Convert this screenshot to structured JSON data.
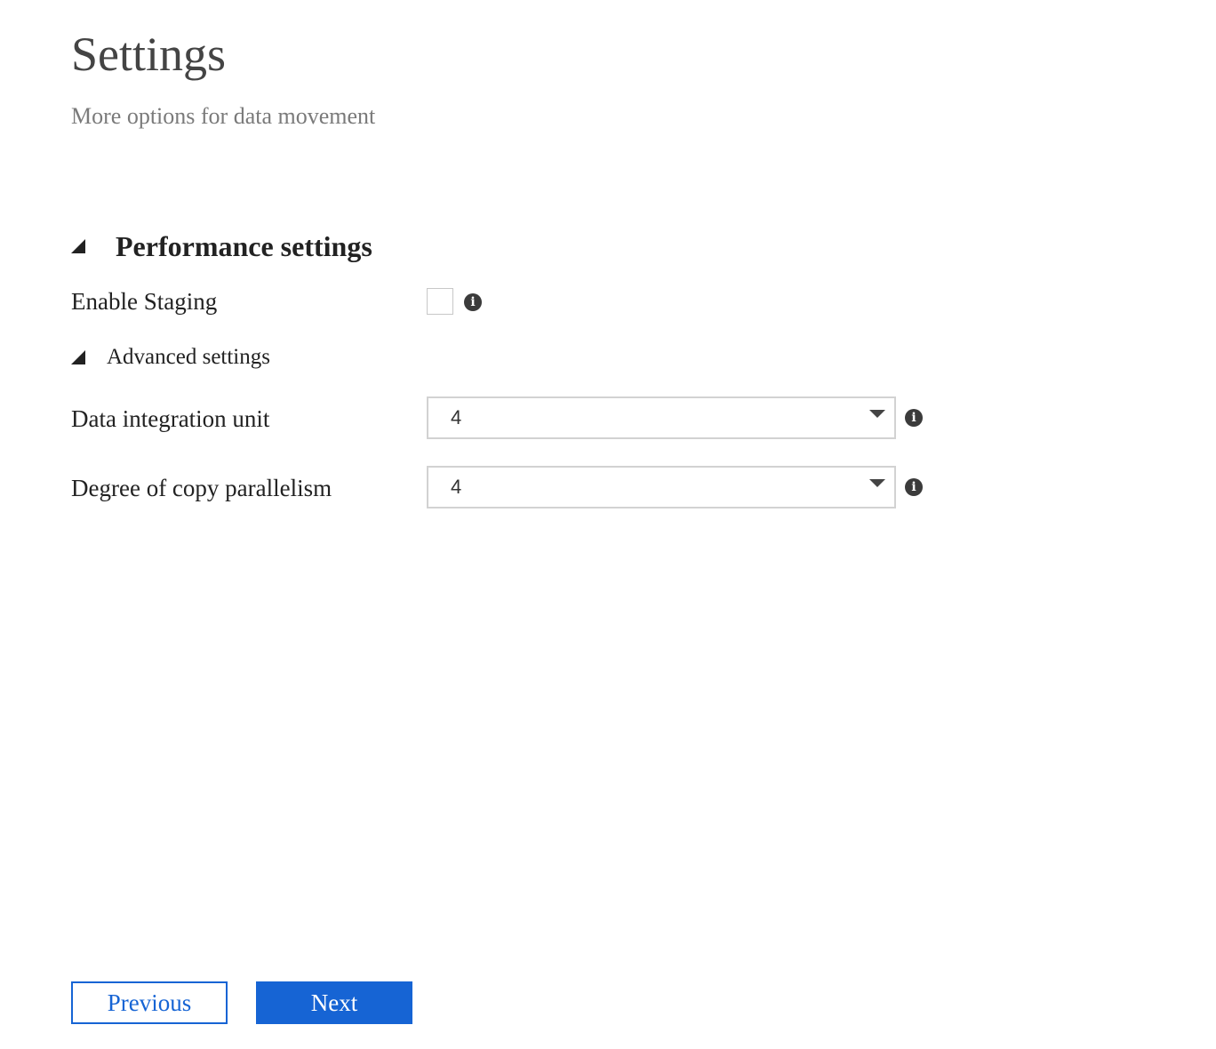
{
  "header": {
    "title": "Settings",
    "subtitle": "More options for data movement"
  },
  "performance": {
    "section_title": "Performance settings",
    "enable_staging": {
      "label": "Enable Staging",
      "checked": false,
      "info_icon": "info-icon"
    },
    "advanced": {
      "title": "Advanced settings",
      "data_integration_unit": {
        "label": "Data integration unit",
        "value": "4"
      },
      "copy_parallelism": {
        "label": "Degree of copy parallelism",
        "value": "4"
      }
    }
  },
  "footer": {
    "previous_label": "Previous",
    "next_label": "Next"
  },
  "colors": {
    "accent": "#1664d4",
    "text": "#222222",
    "subtitle": "#7a7a7a",
    "border": "#d2d2d2"
  }
}
